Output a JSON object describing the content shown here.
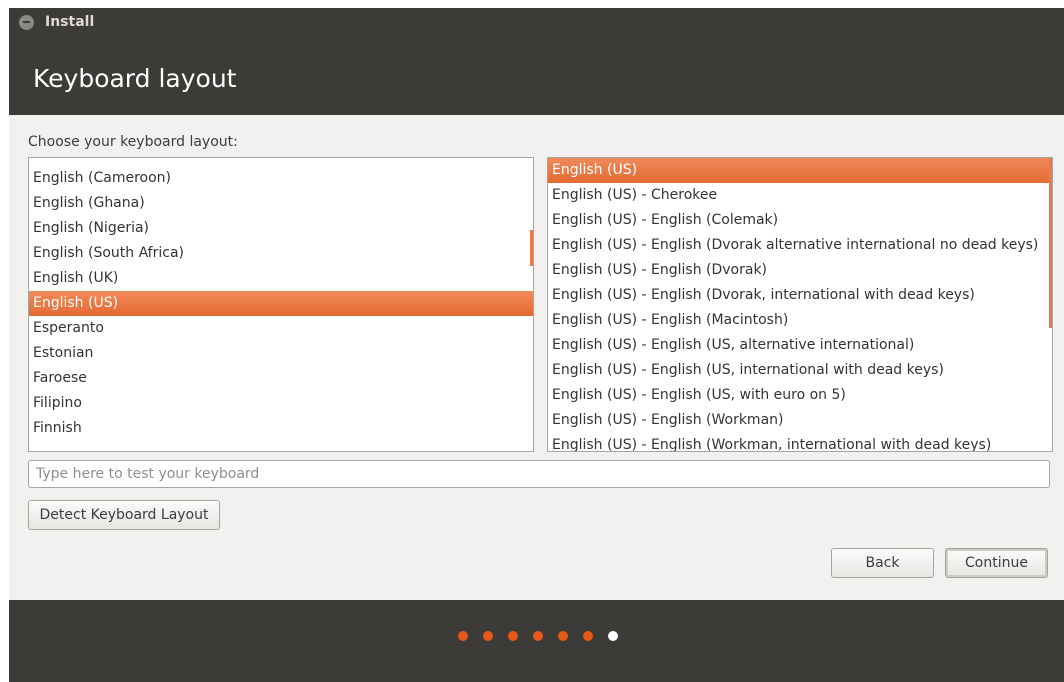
{
  "window": {
    "title": "Install"
  },
  "header": {
    "title": "Keyboard layout"
  },
  "prompt": "Choose your keyboard layout:",
  "left_list": {
    "items": [
      "English (Cameroon)",
      "English (Ghana)",
      "English (Nigeria)",
      "English (South Africa)",
      "English (UK)",
      "English (US)",
      "Esperanto",
      "Estonian",
      "Faroese",
      "Filipino",
      "Finnish"
    ],
    "selected": "English (US)"
  },
  "right_list": {
    "items": [
      "English (US)",
      "English (US) - Cherokee",
      "English (US) - English (Colemak)",
      "English (US) - English (Dvorak alternative international no dead keys)",
      "English (US) - English (Dvorak)",
      "English (US) - English (Dvorak, international with dead keys)",
      "English (US) - English (Macintosh)",
      "English (US) - English (US, alternative international)",
      "English (US) - English (US, international with dead keys)",
      "English (US) - English (US, with euro on 5)",
      "English (US) - English (Workman)",
      "English (US) - English (Workman, international with dead keys)"
    ],
    "selected": "English (US)"
  },
  "test_input": {
    "placeholder": "Type here to test your keyboard",
    "value": ""
  },
  "buttons": {
    "detect": "Detect Keyboard Layout",
    "back": "Back",
    "continue": "Continue"
  },
  "progress": {
    "total_steps": 7,
    "current_step": 7
  },
  "colors": {
    "accent": "#e46a32",
    "dark_bg": "#3c3b37",
    "dot_done": "#e9581b",
    "dot_current": "#ffffff"
  }
}
